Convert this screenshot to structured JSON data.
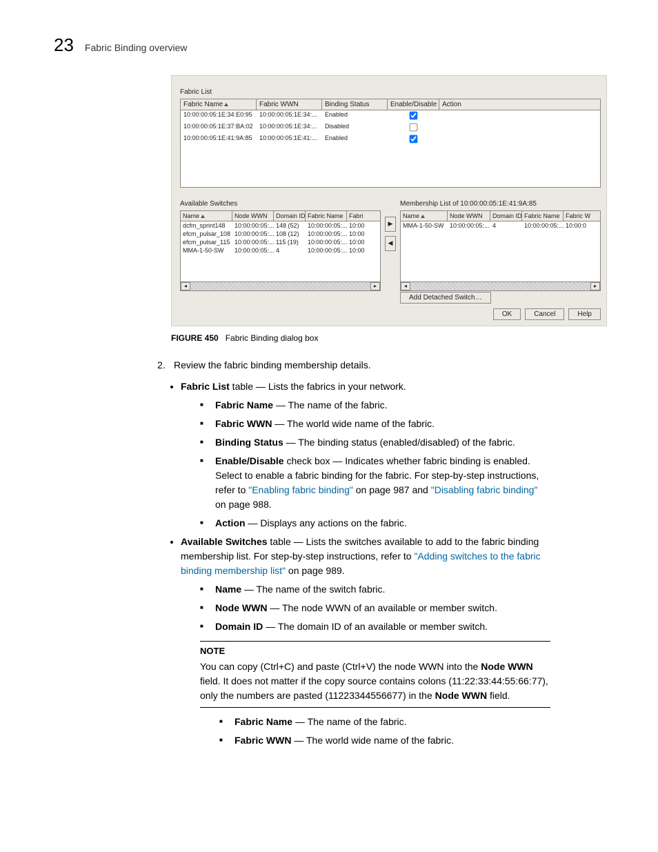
{
  "page": {
    "num": "23",
    "title": "Fabric Binding overview"
  },
  "shot": {
    "fabricList": {
      "label": "Fabric List",
      "headers": [
        "Fabric Name",
        "Fabric WWN",
        "Binding Status",
        "Enable/Disable",
        "Action"
      ],
      "rows": [
        {
          "name": "10:00:00:05:1E:34:E0:95",
          "wwn": "10:00:00:05:1E:34:...",
          "status": "Enabled",
          "chk": true
        },
        {
          "name": "10:00:00:05:1E:37:BA:02",
          "wwn": "10:00:00:05:1E:34:...",
          "status": "Disabled",
          "chk": false
        },
        {
          "name": "10:00:00:05:1E:41:9A:85",
          "wwn": "10:00:00:05:1E:41:...",
          "status": "Enabled",
          "chk": true
        }
      ]
    },
    "avail": {
      "label": "Available Switches",
      "headers": [
        "Name",
        "Node WWN",
        "Domain ID",
        "Fabric Name",
        "Fabri"
      ],
      "rows": [
        {
          "c": [
            "dcfm_sprint148",
            "10:00:00:05:...",
            "148 (52)",
            "10:00:00:05:...",
            "10:00"
          ]
        },
        {
          "c": [
            "efcm_pulsar_108",
            "10:00:00:05:...",
            "108 (12)",
            "10:00:00:05:...",
            "10:00"
          ]
        },
        {
          "c": [
            "efcm_pulsar_115",
            "10:00:00:05:...",
            "115 (19)",
            "10:00:00:05:...",
            "10:00"
          ]
        },
        {
          "c": [
            "MMA-1-50-SW",
            "10:00:00:05:...",
            "4",
            "10:00:00:05:...",
            "10:00"
          ]
        }
      ]
    },
    "member": {
      "label": "Membership List of 10:00:00:05:1E:41:9A:85",
      "headers": [
        "Name",
        "Node WWN",
        "Domain ID",
        "Fabric Name",
        "Fabric W"
      ],
      "rows": [
        {
          "c": [
            "MMA-1-50-SW",
            "10:00:00:05:...",
            "4",
            "10:00:00:05:...",
            "10:00:0"
          ]
        }
      ]
    },
    "addDetached": "Add Detached Switch…",
    "buttons": {
      "ok": "OK",
      "cancel": "Cancel",
      "help": "Help"
    }
  },
  "figure": {
    "label": "FIGURE 450",
    "text": "Fabric Binding dialog box"
  },
  "step": {
    "num": "2.",
    "text": "Review the fabric binding membership details."
  },
  "b1": {
    "lead": "Fabric List",
    "tail": " table — Lists the fabrics in your network.",
    "s1a": "Fabric Name",
    "s1b": " — The name of the fabric.",
    "s2a": "Fabric WWN",
    "s2b": " — The world wide name of the fabric.",
    "s3a": "Binding Status",
    "s3b": " — The binding status (enabled/disabled) of the fabric.",
    "s4a": "Enable/Disable",
    "s4b": " check box — Indicates whether fabric binding is enabled. Select to enable a fabric binding for the fabric. For step-by-step instructions, refer to ",
    "s4link1": "\"Enabling fabric binding\"",
    "s4mid": " on page 987 and ",
    "s4link2": "\"Disabling fabric binding\"",
    "s4end": " on page 988.",
    "s5a": "Action",
    "s5b": " — Displays any actions on the fabric."
  },
  "b2": {
    "lead": "Available Switches",
    "tail1": " table — Lists the switches available to add to the fabric binding membership list. For step-by-step instructions, refer to ",
    "link": "\"Adding switches to the fabric binding membership list\"",
    "tail2": " on page 989.",
    "s1a": "Name",
    "s1b": " — The name of the switch fabric.",
    "s2a": "Node WWN",
    "s2b": " — The node WWN of an available or member switch.",
    "s3a": "Domain ID",
    "s3b": " — The domain ID of an available or member switch."
  },
  "note": {
    "head": "NOTE",
    "p1": "You can copy (Ctrl+C) and paste (Ctrl+V) the node WWN into the ",
    "b1": "Node WWN",
    "p2": " field. It does not matter if the copy source contains colons (11:22:33:44:55:66:77), only the numbers are pasted (11223344556677) in the ",
    "b2": "Node WWN",
    "p3": " field."
  },
  "after": {
    "s1a": "Fabric Name",
    "s1b": " — The name of the fabric.",
    "s2a": "Fabric WWN",
    "s2b": " — The world wide name of the fabric."
  }
}
